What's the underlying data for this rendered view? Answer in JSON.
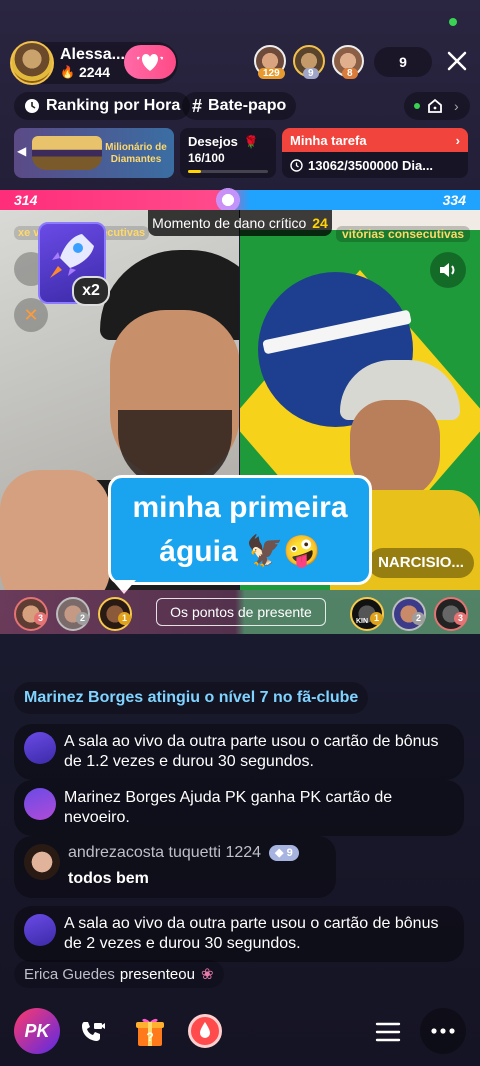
{
  "header": {
    "host_name": "Alessa...",
    "host_likes": "2244",
    "viewer_count": "9",
    "top_viewers": [
      {
        "badge": "129"
      },
      {
        "badge": "9"
      },
      {
        "badge": "8"
      }
    ]
  },
  "toolbar": {
    "ranking_label": "Ranking por Hora",
    "chat_label": "Bate-papo"
  },
  "banner": {
    "promo_line1": "Milionário de",
    "promo_line2": "Diamantes",
    "wishes_label": "Desejos",
    "wishes_progress": "16/100",
    "wishes_fraction": 0.16,
    "task_label": "Minha tarefa",
    "task_progress": "13062/3500000 Dia..."
  },
  "pk": {
    "left_score": "314",
    "right_score": "334",
    "critical_label": "Momento de dano crítico",
    "critical_timer": "24",
    "left_streak": "xe vitórias consecutivas",
    "right_streak": "vitórias consecutivas",
    "multiplier": "x2",
    "right_name": "NARCISIO...",
    "gift_points_label": "Os pontos de presente",
    "caption_line1": "minha primeira",
    "caption_line2": "águia 🦅🤪",
    "left_supporters": [
      "3",
      "2",
      "1"
    ],
    "right_supporters": [
      "1",
      "2",
      "3"
    ],
    "right_first_tag": "KIN"
  },
  "chat": {
    "system_notice": "Marinez Borges atingiu o nível 7 no fã-clube",
    "msg1": "A sala ao vivo da outra parte usou o cartão de bônus de 1.2 vezes e durou 30 segundos.",
    "msg2": "Marinez Borges Ajuda PK ganha PK cartão de nevoeiro.",
    "user_name": "andrezacosta tuquetti 1224",
    "user_level": "9",
    "user_message": "todos bem",
    "msg3": "A sala ao vivo da outra parte usou o cartão de bônus de 2 vezes e durou 30 segundos.",
    "gift_sender": "Erica Guedes",
    "gift_verb": "presenteou"
  },
  "bottom": {
    "pk_label": "PK"
  },
  "colors": {
    "left_team": "#ff2d7a",
    "right_team": "#1fa3ff",
    "task_red": "#f0443c",
    "caption_blue": "#1aa3ef",
    "level_blue": "#7fd3ff"
  }
}
